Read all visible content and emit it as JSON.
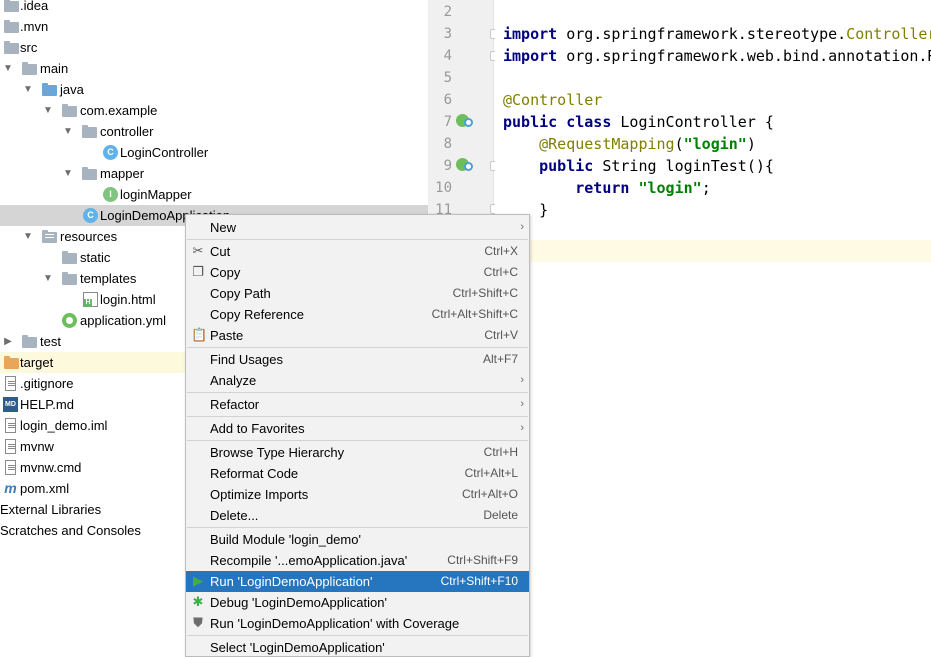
{
  "tree": {
    "items": [
      {
        "label": ".idea"
      },
      {
        "label": ".mvn"
      },
      {
        "label": "src"
      },
      {
        "label": "main"
      },
      {
        "label": "java"
      },
      {
        "label": "com.example"
      },
      {
        "label": "controller"
      },
      {
        "label": "LoginController",
        "icon_text": "C"
      },
      {
        "label": "mapper"
      },
      {
        "label": "loginMapper",
        "icon_text": "I"
      },
      {
        "label": "LoginDemoApplication",
        "icon_text": "C"
      },
      {
        "label": "resources"
      },
      {
        "label": "static"
      },
      {
        "label": "templates"
      },
      {
        "label": "login.html"
      },
      {
        "label": "application.yml"
      },
      {
        "label": "test"
      },
      {
        "label": "target"
      },
      {
        "label": ".gitignore"
      },
      {
        "label": "HELP.md",
        "icon_text": "MD"
      },
      {
        "label": "login_demo.iml"
      },
      {
        "label": "mvnw"
      },
      {
        "label": "mvnw.cmd"
      },
      {
        "label": "pom.xml",
        "icon_text": "m"
      },
      {
        "label": "External Libraries"
      },
      {
        "label": "Scratches and Consoles"
      }
    ]
  },
  "editor": {
    "line_numbers": [
      "2",
      "3",
      "4",
      "5",
      "6",
      "7",
      "8",
      "9",
      "10",
      "11"
    ],
    "lines": {
      "l3_kw": "import",
      "l3_rest": " org.springframework.stereotype.",
      "l3_tail": "Controller;",
      "l4_kw": "import",
      "l4_rest": " org.springframework.web.bind.annotation.RequestMapping;",
      "l6_ann": "@Controller",
      "l7_kw1": "public",
      "l7_kw2": "class",
      "l7_rest": " LoginController {",
      "l8_ann": "@RequestMapping",
      "l8_open": "(",
      "l8_str": "\"login\"",
      "l8_close": ")",
      "l9_kw": "public",
      "l9_rest": " String loginTest(){",
      "l10_kw": "return",
      "l10_str": "\"login\"",
      "l10_end": ";",
      "l11": "}"
    }
  },
  "menu": {
    "items": [
      {
        "label": "New",
        "shortcut": "",
        "submenu": true
      },
      {
        "label": "Cut",
        "shortcut": "Ctrl+X",
        "icon": "scissors-icon"
      },
      {
        "label": "Copy",
        "shortcut": "Ctrl+C",
        "icon": "copy-icon"
      },
      {
        "label": "Copy Path",
        "shortcut": "Ctrl+Shift+C"
      },
      {
        "label": "Copy Reference",
        "shortcut": "Ctrl+Alt+Shift+C"
      },
      {
        "label": "Paste",
        "shortcut": "Ctrl+V",
        "icon": "paste-icon"
      },
      {
        "label": "Find Usages",
        "shortcut": "Alt+F7"
      },
      {
        "label": "Analyze",
        "shortcut": "",
        "submenu": true
      },
      {
        "label": "Refactor",
        "shortcut": "",
        "submenu": true
      },
      {
        "label": "Add to Favorites",
        "shortcut": "",
        "submenu": true
      },
      {
        "label": "Browse Type Hierarchy",
        "shortcut": "Ctrl+H"
      },
      {
        "label": "Reformat Code",
        "shortcut": "Ctrl+Alt+L"
      },
      {
        "label": "Optimize Imports",
        "shortcut": "Ctrl+Alt+O"
      },
      {
        "label": "Delete...",
        "shortcut": "Delete"
      },
      {
        "label": "Build Module 'login_demo'",
        "shortcut": ""
      },
      {
        "label": "Recompile '...emoApplication.java'",
        "shortcut": "Ctrl+Shift+F9"
      },
      {
        "label": "Run 'LoginDemoApplication'",
        "shortcut": "Ctrl+Shift+F10",
        "icon": "run-icon",
        "highlighted": true
      },
      {
        "label": "Debug 'LoginDemoApplication'",
        "shortcut": "",
        "icon": "debug-icon"
      },
      {
        "label": "Run 'LoginDemoApplication' with Coverage",
        "shortcut": "",
        "icon": "coverage-icon"
      },
      {
        "label": "Select 'LoginDemoApplication'",
        "shortcut": ""
      }
    ],
    "submenu_glyph": "›"
  },
  "colors": {
    "selection": "#d5d5d5",
    "menu_highlight": "#2675bf",
    "keyword": "#000080",
    "annotation": "#808000",
    "string": "#008000"
  }
}
